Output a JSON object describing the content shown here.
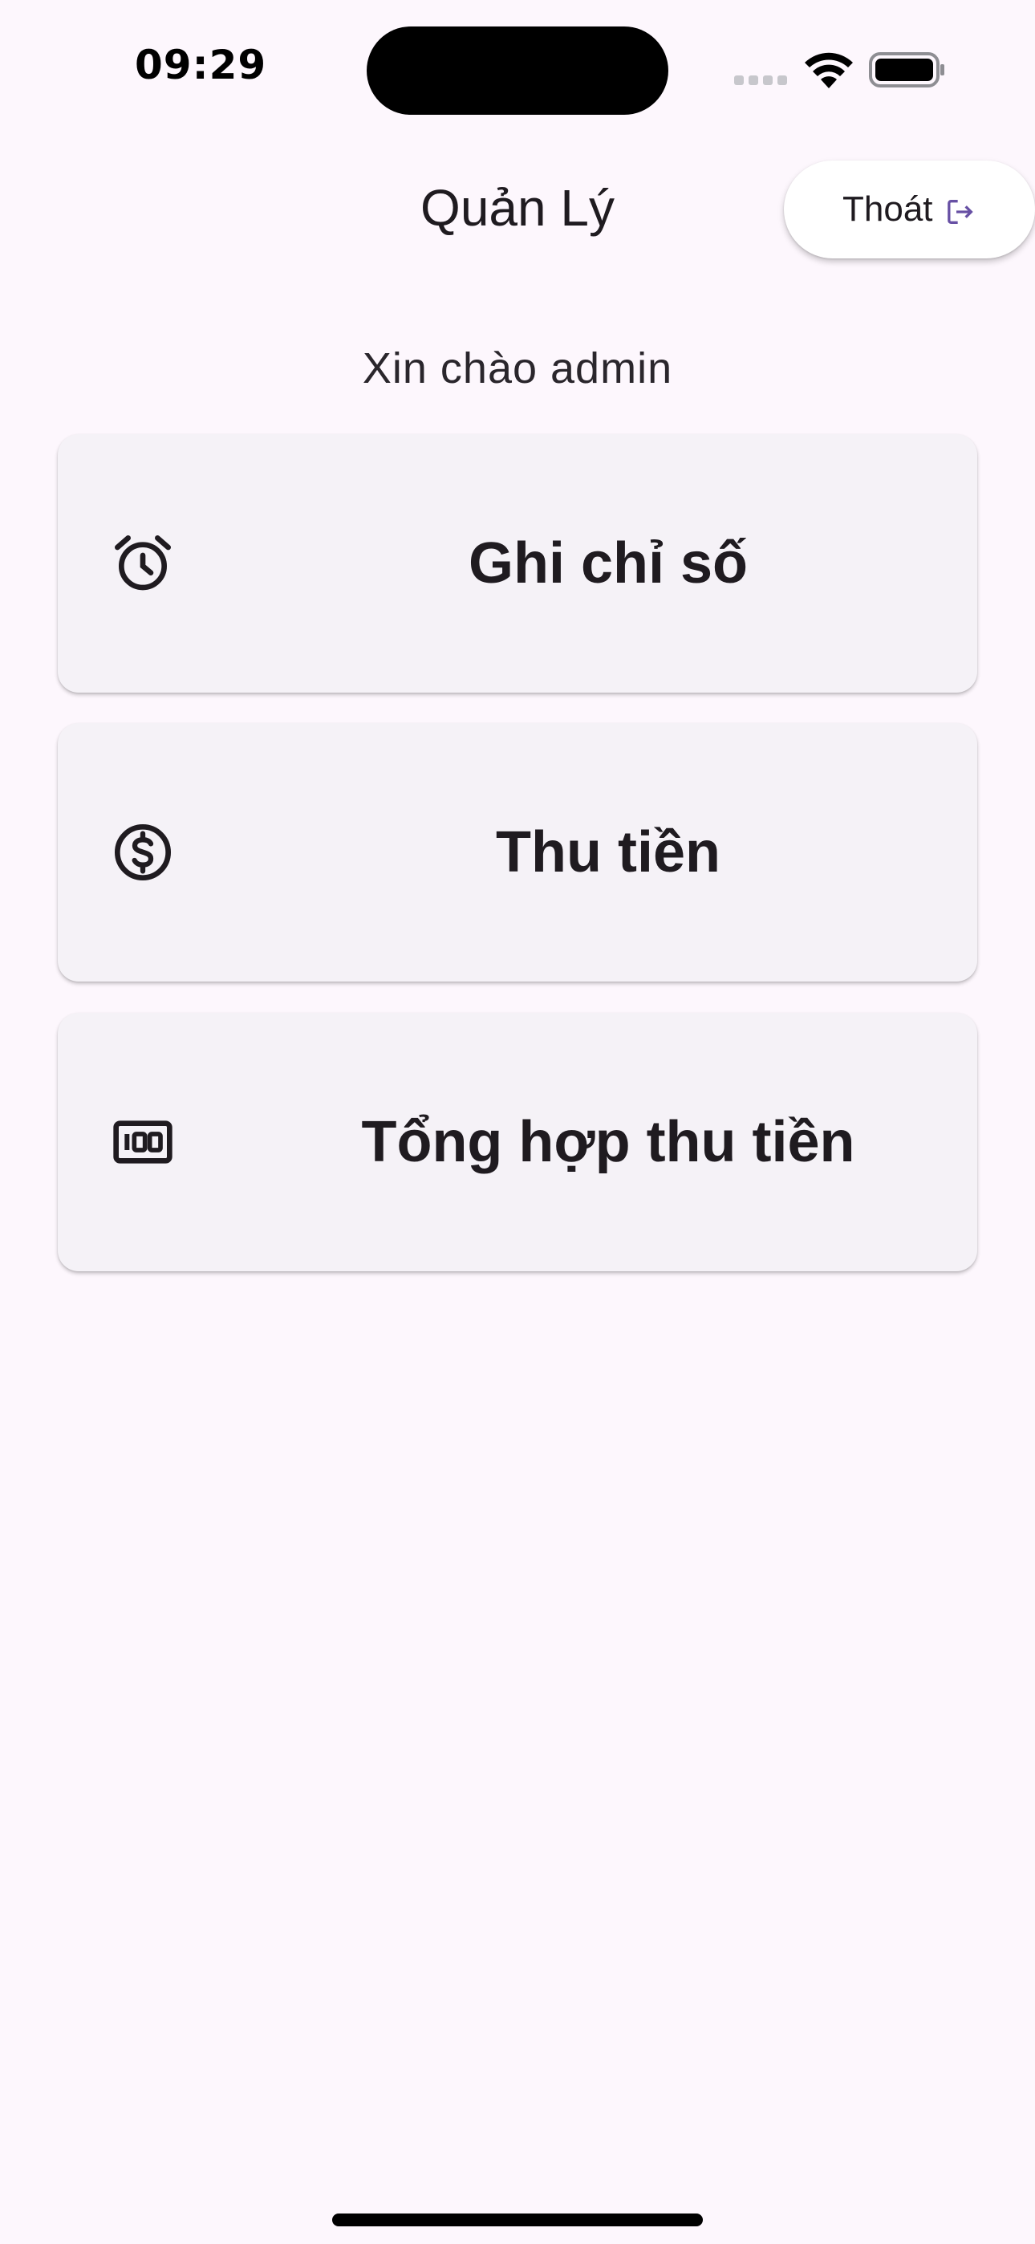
{
  "status_bar": {
    "time": "09:29"
  },
  "header": {
    "title": "Quản Lý",
    "logout_label": "Thoát"
  },
  "greeting": "Xin chào admin",
  "menu": [
    {
      "label": "Ghi chỉ số",
      "icon": "alarm-clock-icon"
    },
    {
      "label": "Thu tiền",
      "icon": "dollar-circle-icon"
    },
    {
      "label": "Tổng hợp thu tiền",
      "icon": "counter-100-icon"
    }
  ],
  "colors": {
    "background": "#FDF7FD",
    "card": "#F5F2F7",
    "text": "#1F1B20",
    "accent": "#6750A4"
  }
}
